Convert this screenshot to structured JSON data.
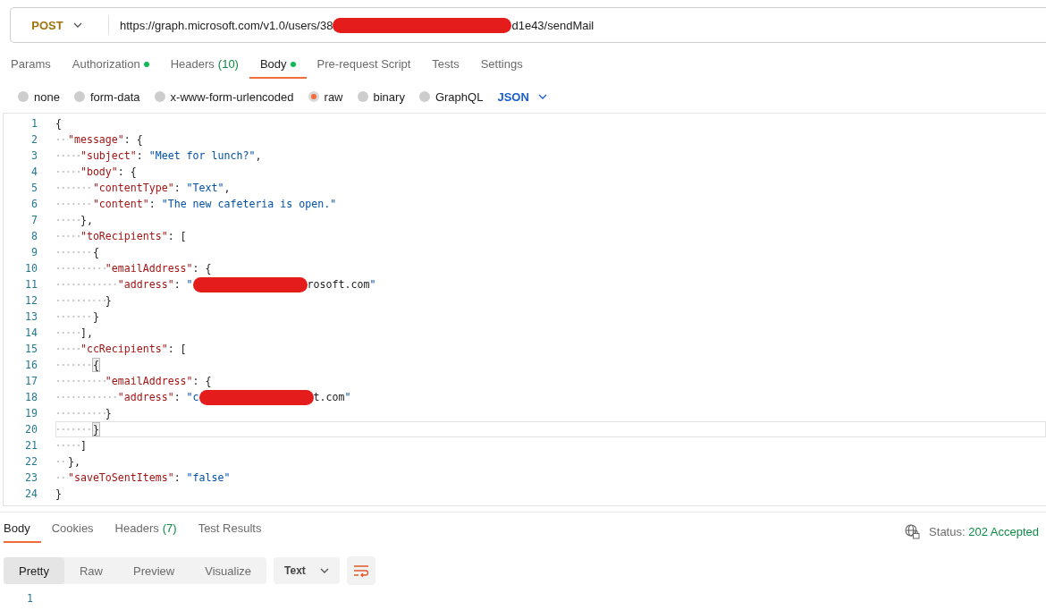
{
  "request": {
    "method": "POST",
    "url_before": "https://graph.microsoft.com/v1.0/users/38",
    "url_after": "d1e43/sendMail"
  },
  "tabs": [
    {
      "label": "Params",
      "dot": false,
      "selected": false
    },
    {
      "label": "Authorization",
      "dot": true,
      "selected": false
    },
    {
      "label": "Headers",
      "count": "(10)",
      "dot": false,
      "selected": false
    },
    {
      "label": "Body",
      "dot": true,
      "selected": true
    },
    {
      "label": "Pre-request Script",
      "dot": false,
      "selected": false
    },
    {
      "label": "Tests",
      "dot": false,
      "selected": false
    },
    {
      "label": "Settings",
      "dot": false,
      "selected": false
    }
  ],
  "body_types": [
    {
      "label": "none",
      "selected": false
    },
    {
      "label": "form-data",
      "selected": false
    },
    {
      "label": "x-www-form-urlencoded",
      "selected": false
    },
    {
      "label": "raw",
      "selected": true
    },
    {
      "label": "binary",
      "selected": false
    },
    {
      "label": "GraphQL",
      "selected": false
    }
  ],
  "language": "JSON",
  "editor": {
    "lines": [
      {
        "number": "1",
        "text": "{",
        "current": false,
        "bracket_match": false
      },
      {
        "number": "2",
        "text": "  \"message\": {",
        "current": false,
        "bracket_match": false
      },
      {
        "number": "3",
        "text": "    \"subject\": \"Meet for lunch?\",",
        "current": false,
        "bracket_match": false
      },
      {
        "number": "4",
        "text": "    \"body\": {",
        "current": false,
        "bracket_match": false
      },
      {
        "number": "5",
        "text": "      \"contentType\": \"Text\",",
        "current": false,
        "bracket_match": false
      },
      {
        "number": "6",
        "text": "      \"content\": \"The new cafeteria is open.\"",
        "current": false,
        "bracket_match": false
      },
      {
        "number": "7",
        "text": "    },",
        "current": false,
        "bracket_match": false
      },
      {
        "number": "8",
        "text": "    \"toRecipients\": [",
        "current": false,
        "bracket_match": false
      },
      {
        "number": "9",
        "text": "      {",
        "current": false,
        "bracket_match": false
      },
      {
        "number": "10",
        "text": "        \"emailAddress\": {",
        "current": false,
        "bracket_match": false
      },
      {
        "number": "11",
        "text": "          \"address\": \"",
        "after": "rosoft.com\"",
        "current": false,
        "bracket_match": false
      },
      {
        "number": "12",
        "text": "        }",
        "current": false,
        "bracket_match": false
      },
      {
        "number": "13",
        "text": "      }",
        "current": false,
        "bracket_match": false
      },
      {
        "number": "14",
        "text": "    ],",
        "current": false,
        "bracket_match": false
      },
      {
        "number": "15",
        "text": "    \"ccRecipients\": [",
        "current": false,
        "bracket_match": false
      },
      {
        "number": "16",
        "text": "      {",
        "current": false,
        "bracket_match": true
      },
      {
        "number": "17",
        "text": "        \"emailAddress\": {",
        "current": false,
        "bracket_match": false
      },
      {
        "number": "18",
        "text": "          \"address\": \"c",
        "after": "t.com\"",
        "current": false,
        "bracket_match": false
      },
      {
        "number": "19",
        "text": "        }",
        "current": false,
        "bracket_match": false
      },
      {
        "number": "20",
        "text": "      }",
        "current": true,
        "bracket_match": true
      },
      {
        "number": "21",
        "text": "    ]",
        "current": false,
        "bracket_match": false
      },
      {
        "number": "22",
        "text": "  },",
        "current": false,
        "bracket_match": false
      },
      {
        "number": "23",
        "text": "  \"saveToSentItems\": \"false\"",
        "current": false,
        "bracket_match": false
      },
      {
        "number": "24",
        "text": "}",
        "current": false,
        "bracket_match": false
      }
    ]
  },
  "response": {
    "tabs": [
      {
        "label": "Body",
        "selected": true
      },
      {
        "label": "Cookies",
        "selected": false
      },
      {
        "label": "Headers",
        "count": "(7)",
        "selected": false
      },
      {
        "label": "Test Results",
        "selected": false
      }
    ],
    "status_label": "Status:",
    "status": "202 Accepted",
    "views": [
      {
        "label": "Pretty",
        "selected": true
      },
      {
        "label": "Raw",
        "selected": false
      },
      {
        "label": "Preview",
        "selected": false
      },
      {
        "label": "Visualize",
        "selected": false
      }
    ],
    "format": "Text",
    "lines": [
      "1"
    ]
  }
}
